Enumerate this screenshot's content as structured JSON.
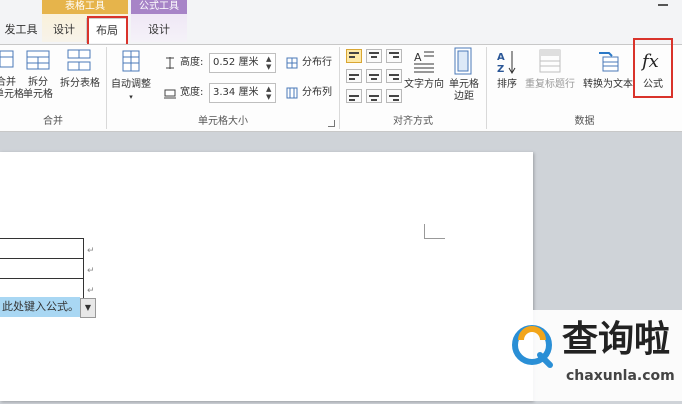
{
  "titlebar": {
    "partial_tab_left": "发工具",
    "table_tools_header": "表格工具",
    "table_tabs": [
      "设计",
      "布局"
    ],
    "formula_tools_header": "公式工具",
    "formula_tabs": [
      "设计"
    ],
    "colors": {
      "table_tools": "#e6b44b",
      "formula_tools": "#a784c7"
    }
  },
  "ribbon": {
    "merge_group": {
      "label": "合并",
      "merge_cells": [
        "合并",
        "单元格"
      ],
      "split_cells": [
        "拆分",
        "单元格"
      ],
      "split_table": "拆分表格"
    },
    "cell_size_group": {
      "label": "单元格大小",
      "autofit": "自动调整",
      "height_label": "高度:",
      "height_value": "0.52 厘米",
      "width_label": "宽度:",
      "width_value": "3.34 厘米",
      "distribute_rows": "分布行",
      "distribute_columns": "分布列"
    },
    "alignment_group": {
      "label": "对齐方式",
      "text_direction": "文字方向",
      "cell_margins": [
        "单元格",
        "边距"
      ]
    },
    "data_group": {
      "label": "数据",
      "sort": "排序",
      "repeat_header": "重复标题行",
      "convert_to_text": "转换为文本",
      "formula": "公式"
    }
  },
  "document": {
    "formula_field_text": "此处键入公式。"
  },
  "watermark": {
    "brand": "查询啦",
    "url": "chaxunla.com"
  }
}
